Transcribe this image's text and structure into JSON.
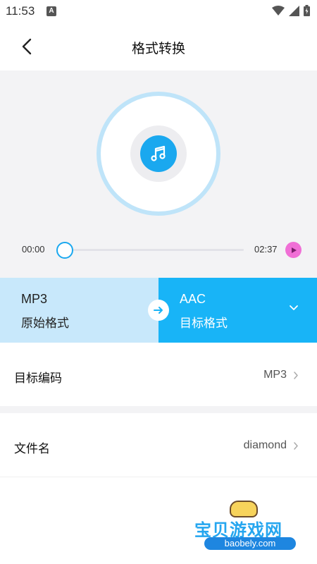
{
  "status_bar": {
    "time": "11:53",
    "notification_badge": "A"
  },
  "nav": {
    "title": "格式转换"
  },
  "player": {
    "current_time": "00:00",
    "total_time": "02:37",
    "progress": 0,
    "accent_color": "#1aa8ef",
    "play_color": "#f06fd6"
  },
  "formats": {
    "source": {
      "name": "MP3",
      "label": "原始格式"
    },
    "target": {
      "name": "AAC",
      "label": "目标格式"
    }
  },
  "settings": {
    "encoding": {
      "label": "目标编码",
      "value": "MP3"
    },
    "filename": {
      "label": "文件名",
      "value": "diamond"
    }
  },
  "watermark": {
    "title": "宝贝游戏网",
    "url": "baobely.com"
  }
}
